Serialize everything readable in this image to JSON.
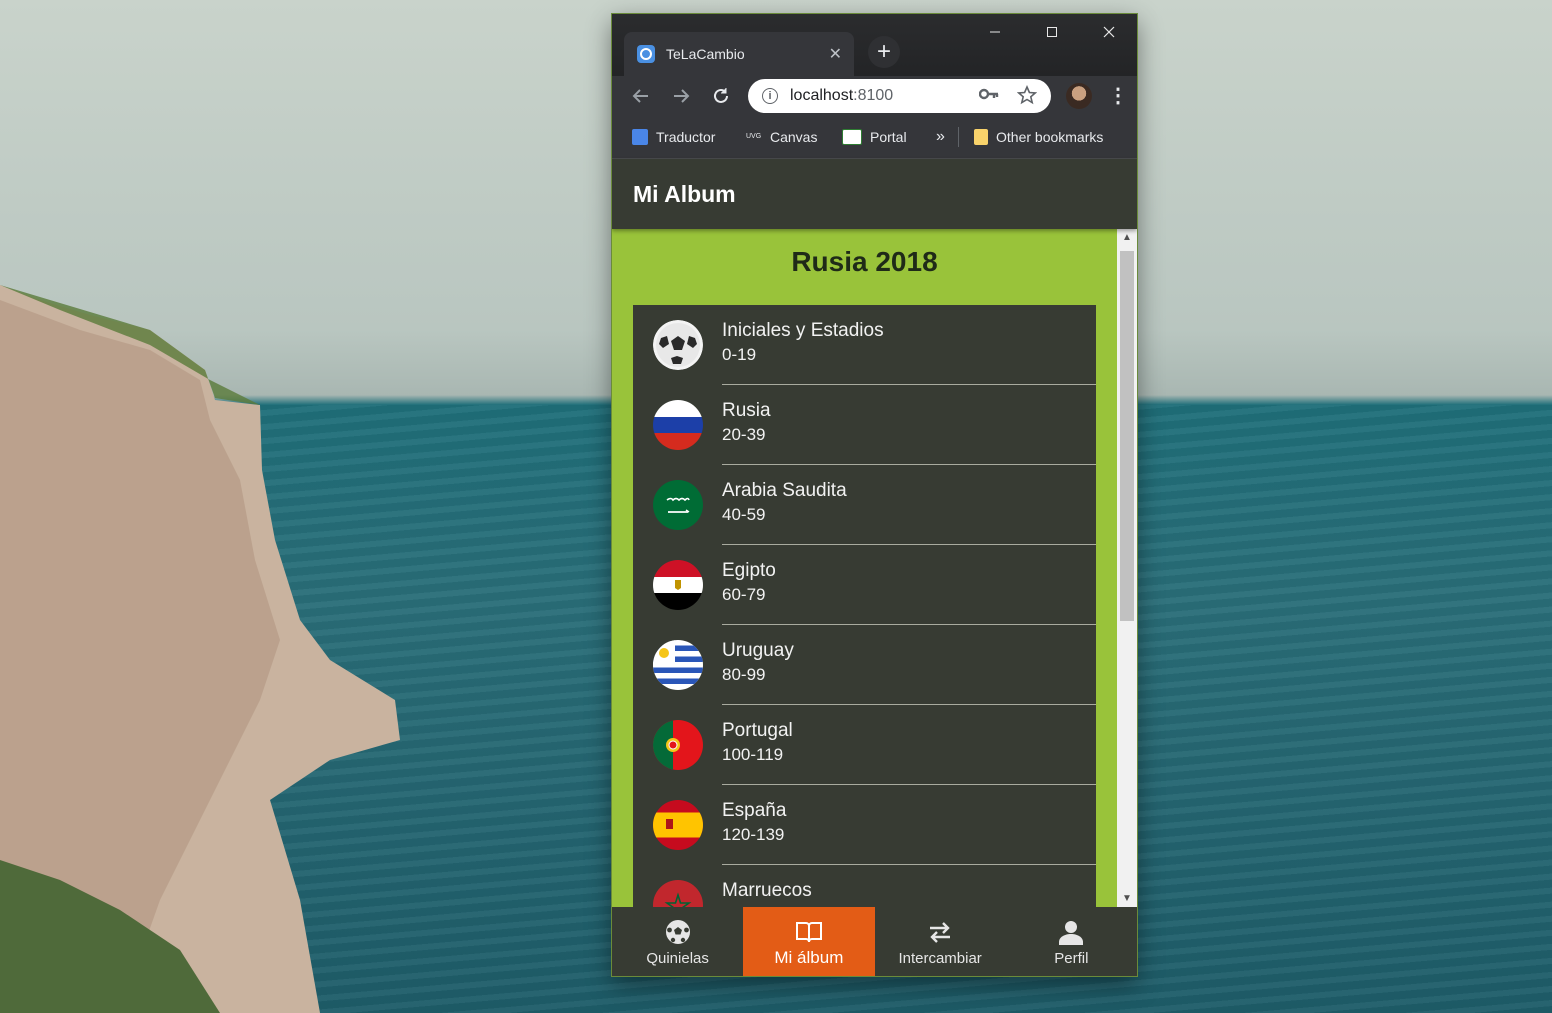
{
  "browser": {
    "tab_title": "TeLaCambio",
    "tab_close": "✕",
    "new_tab": "+",
    "url_host": "localhost",
    "url_port": ":8100",
    "bookmarks": [
      {
        "label": "Traductor"
      },
      {
        "label": "Canvas"
      },
      {
        "label": "Portal"
      }
    ],
    "bookmarks_overflow": "»",
    "other_bookmarks": "Other bookmarks"
  },
  "app": {
    "header_title": "Mi Album",
    "section_title": "Rusia 2018",
    "items": [
      {
        "name": "Iniciales y Estadios",
        "range": "0-19",
        "icon": "soccer-ball-icon"
      },
      {
        "name": "Rusia",
        "range": "20-39",
        "icon": "russia-flag-icon"
      },
      {
        "name": "Arabia Saudita",
        "range": "40-59",
        "icon": "saudi-arabia-flag-icon"
      },
      {
        "name": "Egipto",
        "range": "60-79",
        "icon": "egypt-flag-icon"
      },
      {
        "name": "Uruguay",
        "range": "80-99",
        "icon": "uruguay-flag-icon"
      },
      {
        "name": "Portugal",
        "range": "100-119",
        "icon": "portugal-flag-icon"
      },
      {
        "name": "España",
        "range": "120-139",
        "icon": "spain-flag-icon"
      },
      {
        "name": "Marruecos",
        "range": "",
        "icon": "morocco-flag-icon"
      }
    ],
    "tabs": [
      {
        "label": "Quinielas",
        "icon": "soccer-ball-icon",
        "active": false
      },
      {
        "label": "Mi álbum",
        "icon": "book-icon",
        "active": true
      },
      {
        "label": "Intercambiar",
        "icon": "swap-arrows-icon",
        "active": false
      },
      {
        "label": "Perfil",
        "icon": "person-icon",
        "active": false
      }
    ]
  },
  "colors": {
    "accent_green": "#99c33a",
    "dark_panel": "#373b33",
    "active_tab": "#e35c16"
  }
}
